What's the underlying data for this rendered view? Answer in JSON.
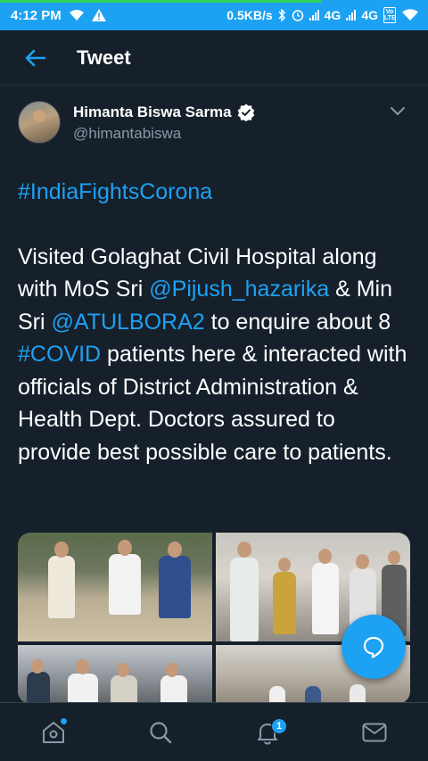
{
  "status_bar": {
    "time": "4:12 PM",
    "speed": "0.5KB/s",
    "net1": "4G",
    "net2": "4G",
    "volte": "Vo LTE"
  },
  "header": {
    "title": "Tweet"
  },
  "tweet": {
    "author_name": "Himanta Biswa Sarma",
    "author_handle": "@himantabiswa",
    "hashtag": "#IndiaFightsCorona",
    "text_parts": {
      "p1": "Visited Golaghat Civil Hospital along with MoS Sri ",
      "mention1": "@Pijush_hazarika",
      "p2": " & Min Sri ",
      "mention2": "@ATULBORA2",
      "p3": " to enquire about 8 ",
      "hashtag2": "#COVID",
      "p4": " patients here & interacted with officials of District Administration & Health Dept. Doctors assured to provide best possible care to patients."
    },
    "media_count": 4
  },
  "bottom_nav": {
    "items": [
      "home-icon",
      "search-icon",
      "bell-icon",
      "mail-icon"
    ],
    "notification_count": "1"
  },
  "colors": {
    "background": "#15202b",
    "accent": "#1da1f2",
    "secondary_text": "#8899a6"
  }
}
